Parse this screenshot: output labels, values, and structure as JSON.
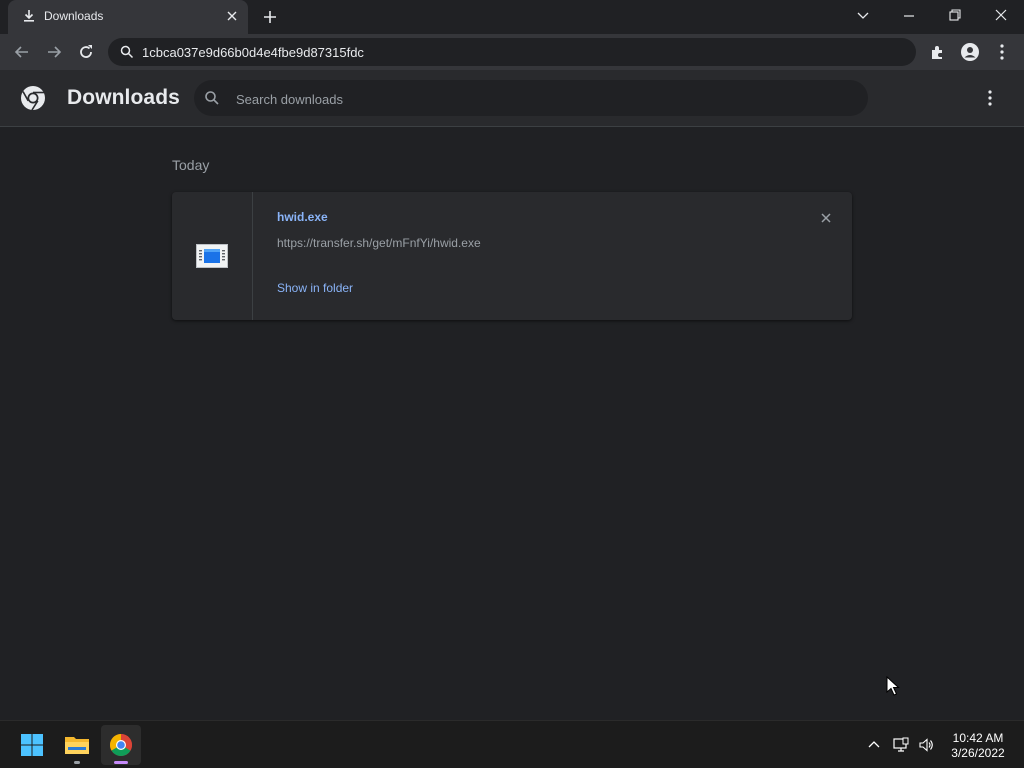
{
  "browser": {
    "tab": {
      "title": "Downloads",
      "icon": "download-icon"
    },
    "omnibox": {
      "text": "1cbca037e9d66b0d4e4fbe9d87315fdc"
    }
  },
  "page": {
    "title": "Downloads",
    "search_placeholder": "Search downloads",
    "sections": [
      {
        "label": "Today",
        "items": [
          {
            "file_name": "hwid.exe",
            "url": "https://transfer.sh/get/mFnfYi/hwid.exe",
            "action": "Show in folder"
          }
        ]
      }
    ]
  },
  "taskbar": {
    "apps": [
      "start",
      "file-explorer",
      "chrome"
    ],
    "time": "10:42 AM",
    "date": "3/26/2022"
  },
  "colors": {
    "background": "#202124",
    "toolbar": "#35363a",
    "card": "#292a2d",
    "link": "#8ab4f8",
    "secondary_text": "#9aa0a6"
  }
}
